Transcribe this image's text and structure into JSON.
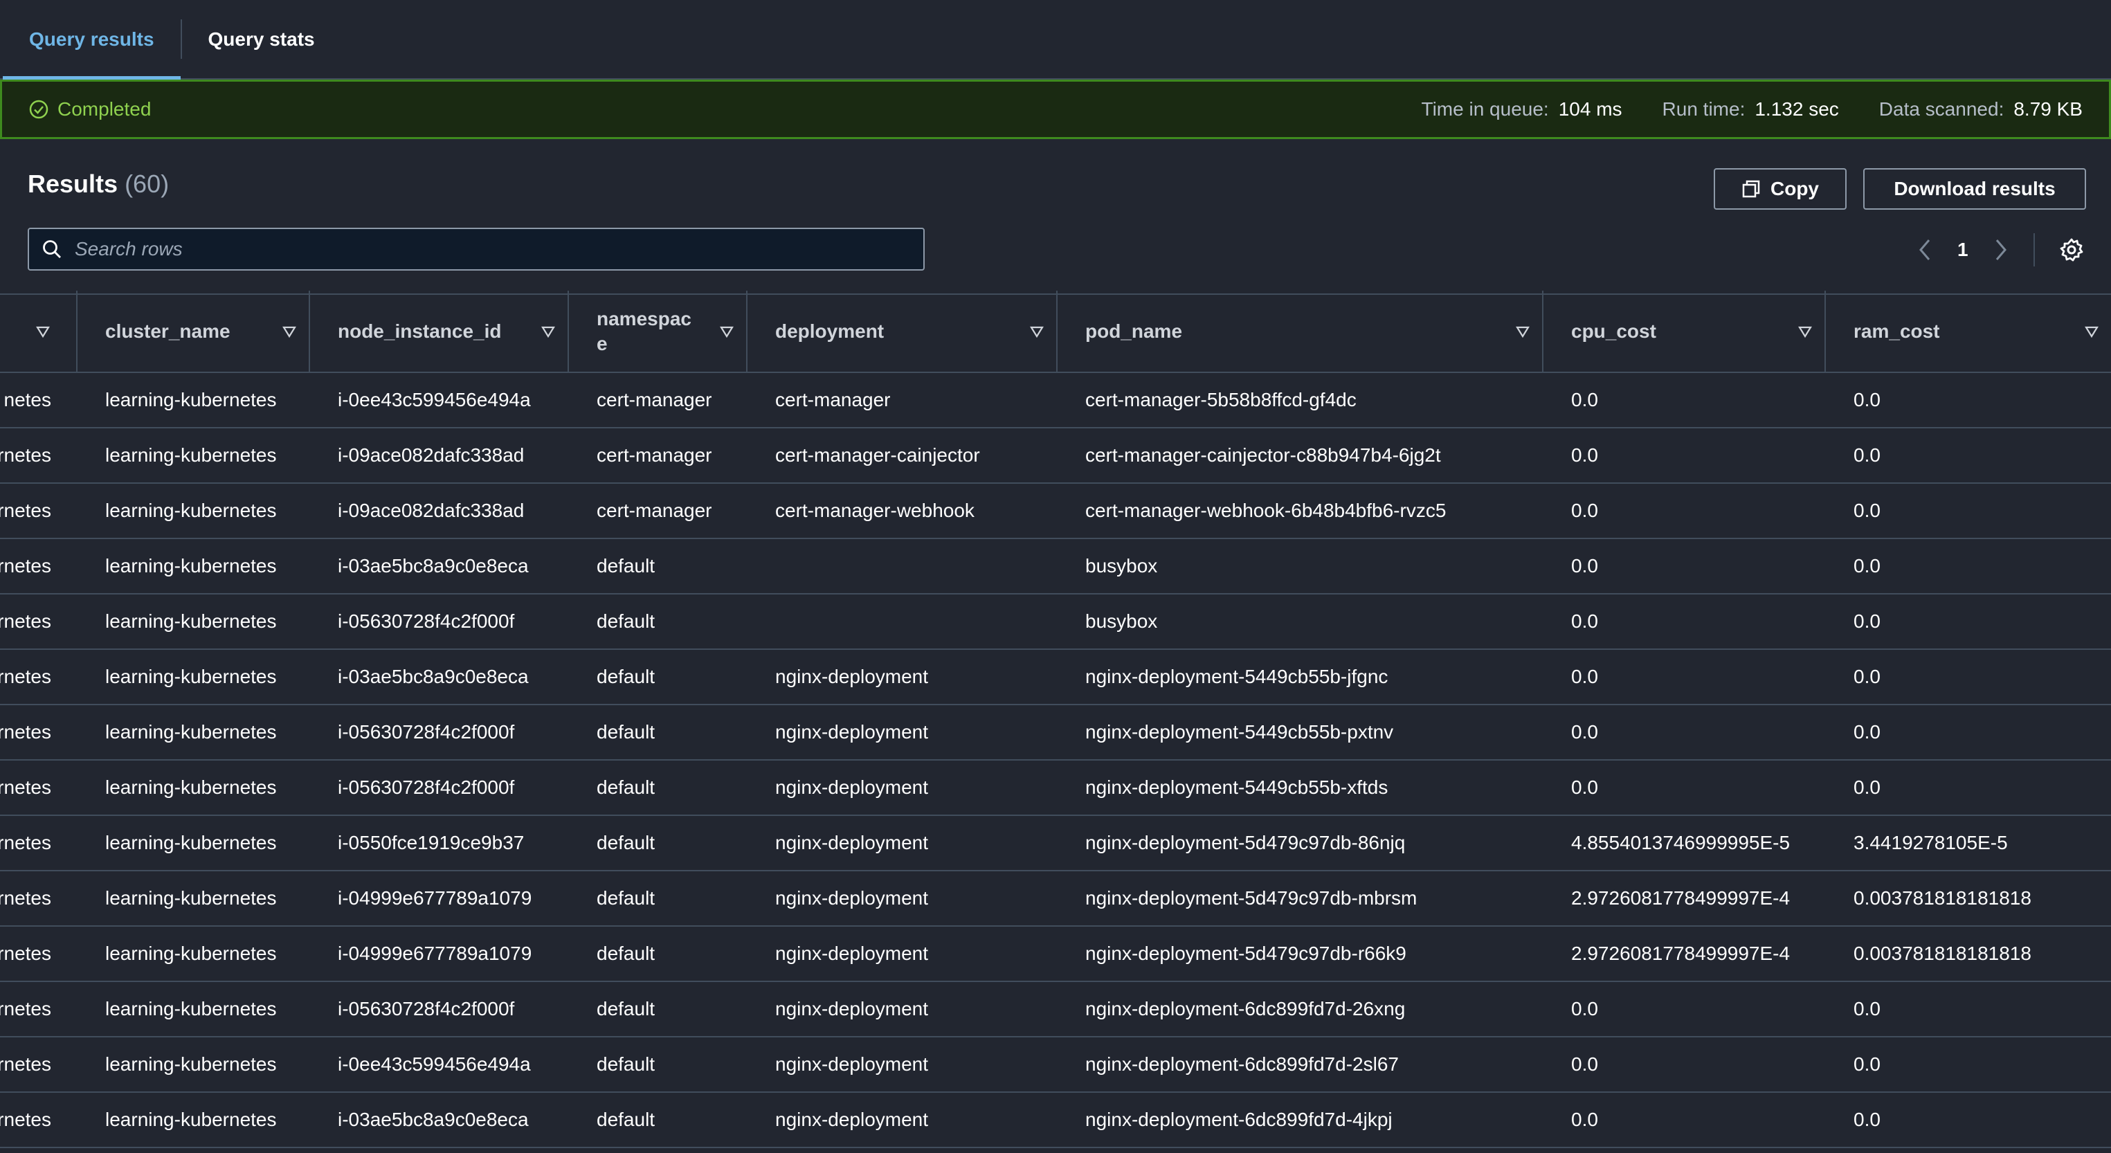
{
  "tabs": [
    {
      "label": "Query results"
    },
    {
      "label": "Query stats"
    }
  ],
  "status": {
    "label": "Completed",
    "time_in_queue_label": "Time in queue:",
    "time_in_queue": "104 ms",
    "run_time_label": "Run time:",
    "run_time": "1.132 sec",
    "data_scanned_label": "Data scanned:",
    "data_scanned": "8.79 KB",
    "color": "#8fd14f"
  },
  "results": {
    "title": "Results",
    "count": "(60)",
    "copy_label": "Copy",
    "download_label": "Download results",
    "search_placeholder": "Search rows",
    "page": "1"
  },
  "table": {
    "columns": [
      "",
      "cluster_name",
      "node_instance_id",
      "namespace",
      "deployment",
      "pod_name",
      "cpu_cost",
      "ram_cost"
    ],
    "rows": [
      [
        "netes",
        "learning-kubernetes",
        "i-0ee43c599456e494a",
        "cert-manager",
        "cert-manager",
        "cert-manager-5b58b8ffcd-gf4dc",
        "0.0",
        "0.0"
      ],
      [
        "rnetes",
        "learning-kubernetes",
        "i-09ace082dafc338ad",
        "cert-manager",
        "cert-manager-cainjector",
        "cert-manager-cainjector-c88b947b4-6jg2t",
        "0.0",
        "0.0"
      ],
      [
        "rnetes",
        "learning-kubernetes",
        "i-09ace082dafc338ad",
        "cert-manager",
        "cert-manager-webhook",
        "cert-manager-webhook-6b48b4bfb6-rvzc5",
        "0.0",
        "0.0"
      ],
      [
        "rnetes",
        "learning-kubernetes",
        "i-03ae5bc8a9c0e8eca",
        "default",
        "",
        "busybox",
        "0.0",
        "0.0"
      ],
      [
        "rnetes",
        "learning-kubernetes",
        "i-05630728f4c2f000f",
        "default",
        "",
        "busybox",
        "0.0",
        "0.0"
      ],
      [
        "rnetes",
        "learning-kubernetes",
        "i-03ae5bc8a9c0e8eca",
        "default",
        "nginx-deployment",
        "nginx-deployment-5449cb55b-jfgnc",
        "0.0",
        "0.0"
      ],
      [
        "rnetes",
        "learning-kubernetes",
        "i-05630728f4c2f000f",
        "default",
        "nginx-deployment",
        "nginx-deployment-5449cb55b-pxtnv",
        "0.0",
        "0.0"
      ],
      [
        "rnetes",
        "learning-kubernetes",
        "i-05630728f4c2f000f",
        "default",
        "nginx-deployment",
        "nginx-deployment-5449cb55b-xftds",
        "0.0",
        "0.0"
      ],
      [
        "rnetes",
        "learning-kubernetes",
        "i-0550fce1919ce9b37",
        "default",
        "nginx-deployment",
        "nginx-deployment-5d479c97db-86njq",
        "4.8554013746999995E-5",
        "3.4419278105E-5"
      ],
      [
        "rnetes",
        "learning-kubernetes",
        "i-04999e677789a1079",
        "default",
        "nginx-deployment",
        "nginx-deployment-5d479c97db-mbrsm",
        "2.9726081778499997E-4",
        "0.003781818181818"
      ],
      [
        "rnetes",
        "learning-kubernetes",
        "i-04999e677789a1079",
        "default",
        "nginx-deployment",
        "nginx-deployment-5d479c97db-r66k9",
        "2.9726081778499997E-4",
        "0.003781818181818"
      ],
      [
        "rnetes",
        "learning-kubernetes",
        "i-05630728f4c2f000f",
        "default",
        "nginx-deployment",
        "nginx-deployment-6dc899fd7d-26xng",
        "0.0",
        "0.0"
      ],
      [
        "rnetes",
        "learning-kubernetes",
        "i-0ee43c599456e494a",
        "default",
        "nginx-deployment",
        "nginx-deployment-6dc899fd7d-2sl67",
        "0.0",
        "0.0"
      ],
      [
        "rnetes",
        "learning-kubernetes",
        "i-03ae5bc8a9c0e8eca",
        "default",
        "nginx-deployment",
        "nginx-deployment-6dc899fd7d-4jkpj",
        "0.0",
        "0.0"
      ]
    ]
  }
}
